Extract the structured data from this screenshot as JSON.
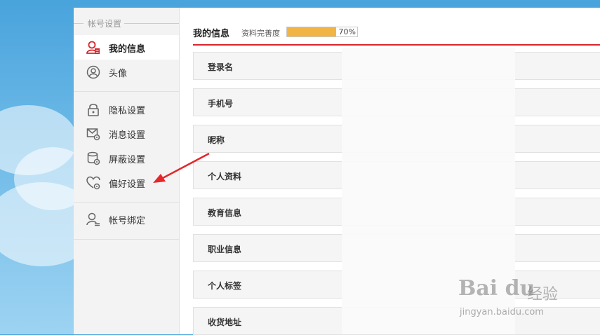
{
  "sidebar": {
    "section_title": "帐号设置",
    "items": [
      {
        "label": "我的信息",
        "icon": "user-info-icon",
        "active": true
      },
      {
        "label": "头像",
        "icon": "avatar-icon"
      },
      {
        "label": "隐私设置",
        "icon": "lock-icon"
      },
      {
        "label": "消息设置",
        "icon": "message-settings-icon"
      },
      {
        "label": "屏蔽设置",
        "icon": "block-settings-icon"
      },
      {
        "label": "偏好设置",
        "icon": "preference-heart-icon"
      },
      {
        "label": "帐号绑定",
        "icon": "account-bind-icon"
      }
    ]
  },
  "main": {
    "title": "我的信息",
    "completeness_label": "资料完善度",
    "completeness_value": 0.7,
    "completeness_text": "70%",
    "rows": [
      {
        "label": "登录名"
      },
      {
        "label": "手机号"
      },
      {
        "label": "昵称"
      },
      {
        "label": "个人资料"
      },
      {
        "label": "教育信息"
      },
      {
        "label": "职业信息"
      },
      {
        "label": "个人标签"
      },
      {
        "label": "收货地址"
      }
    ]
  },
  "watermark": {
    "logo": "Bai du",
    "brand_cn": "经验",
    "url": "jingyan.baidu.com"
  },
  "colors": {
    "accent_red": "#d8262c",
    "progress_fill": "#f2b544",
    "sidebar_bg": "#f3f3f3"
  }
}
